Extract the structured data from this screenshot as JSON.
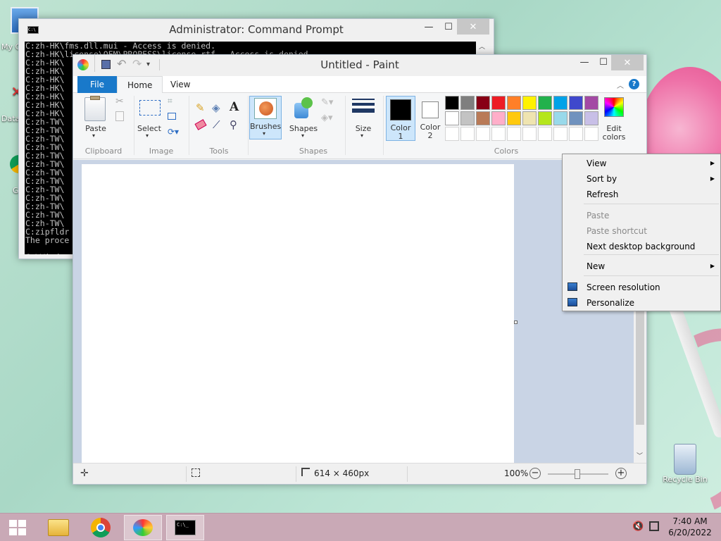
{
  "desktop": {
    "icons": [
      {
        "label": "My C"
      },
      {
        "label": "Data"
      },
      {
        "label": "G"
      },
      {
        "label": "Recycle Bin"
      }
    ]
  },
  "cmd": {
    "title": "Administrator: Command Prompt",
    "lines": [
      "C:zh-HK\\fms.dll.mui - Access is denied.",
      "C:zh-HK\\license\\OEM\\PROPESS\\license.rtf - Access is denied.",
      "C:zh-HK\\",
      "C:zh-HK\\",
      "C:zh-HK\\",
      "C:zh-HK\\",
      "C:zh-HK\\",
      "C:zh-HK\\",
      "C:zh-HK\\",
      "C:zh-TW\\",
      "C:zh-TW\\",
      "C:zh-TW\\",
      "C:zh-TW\\",
      "C:zh-TW\\",
      "C:zh-TW\\",
      "C:zh-TW\\",
      "C:zh-TW\\",
      "C:zh-TW\\",
      "C:zh-TW\\",
      "C:zh-TW\\",
      "C:zh-TW\\",
      "C:zh-TW\\",
      "C:zipfldr",
      "The proce",
      "",
      "C:\\Windo"
    ]
  },
  "paint": {
    "title": "Untitled - Paint",
    "tabs": {
      "file": "File",
      "home": "Home",
      "view": "View"
    },
    "groups": {
      "clipboard": "Clipboard",
      "image": "Image",
      "tools": "Tools",
      "shapes": "Shapes",
      "colors": "Colors"
    },
    "buttons": {
      "paste": "Paste",
      "select": "Select",
      "brushes": "Brushes",
      "shapes": "Shapes",
      "size": "Size",
      "color1_line1": "Color",
      "color1_line2": "1",
      "color2_line1": "Color",
      "color2_line2": "2",
      "edit_colors_line1": "Edit",
      "edit_colors_line2": "colors"
    },
    "palette_row1": [
      "#000000",
      "#7f7f7f",
      "#880015",
      "#ed1c24",
      "#ff7f27",
      "#fff200",
      "#22b14c",
      "#00a2e8",
      "#3f48cc",
      "#a349a4"
    ],
    "palette_row2": [
      "#ffffff",
      "#c3c3c3",
      "#b97a57",
      "#ffaec9",
      "#ffc90e",
      "#efe4b0",
      "#b5e61d",
      "#99d9ea",
      "#7092be",
      "#c8bfe7"
    ],
    "color1": "#000000",
    "color2": "#ffffff",
    "status": {
      "size": "614 × 460px",
      "zoom": "100%"
    }
  },
  "context_menu": {
    "items": [
      {
        "label": "View",
        "submenu": true,
        "enabled": true
      },
      {
        "label": "Sort by",
        "submenu": true,
        "enabled": true
      },
      {
        "label": "Refresh",
        "submenu": false,
        "enabled": true
      },
      {
        "label": "Paste",
        "submenu": false,
        "enabled": false
      },
      {
        "label": "Paste shortcut",
        "submenu": false,
        "enabled": false
      },
      {
        "label": "Next desktop background",
        "submenu": false,
        "enabled": true
      },
      {
        "label": "New",
        "submenu": true,
        "enabled": true
      },
      {
        "label": "Screen resolution",
        "submenu": false,
        "enabled": true
      },
      {
        "label": "Personalize",
        "submenu": false,
        "enabled": true
      }
    ]
  },
  "taskbar": {
    "time": "7:40 AM",
    "date": "6/20/2022"
  }
}
